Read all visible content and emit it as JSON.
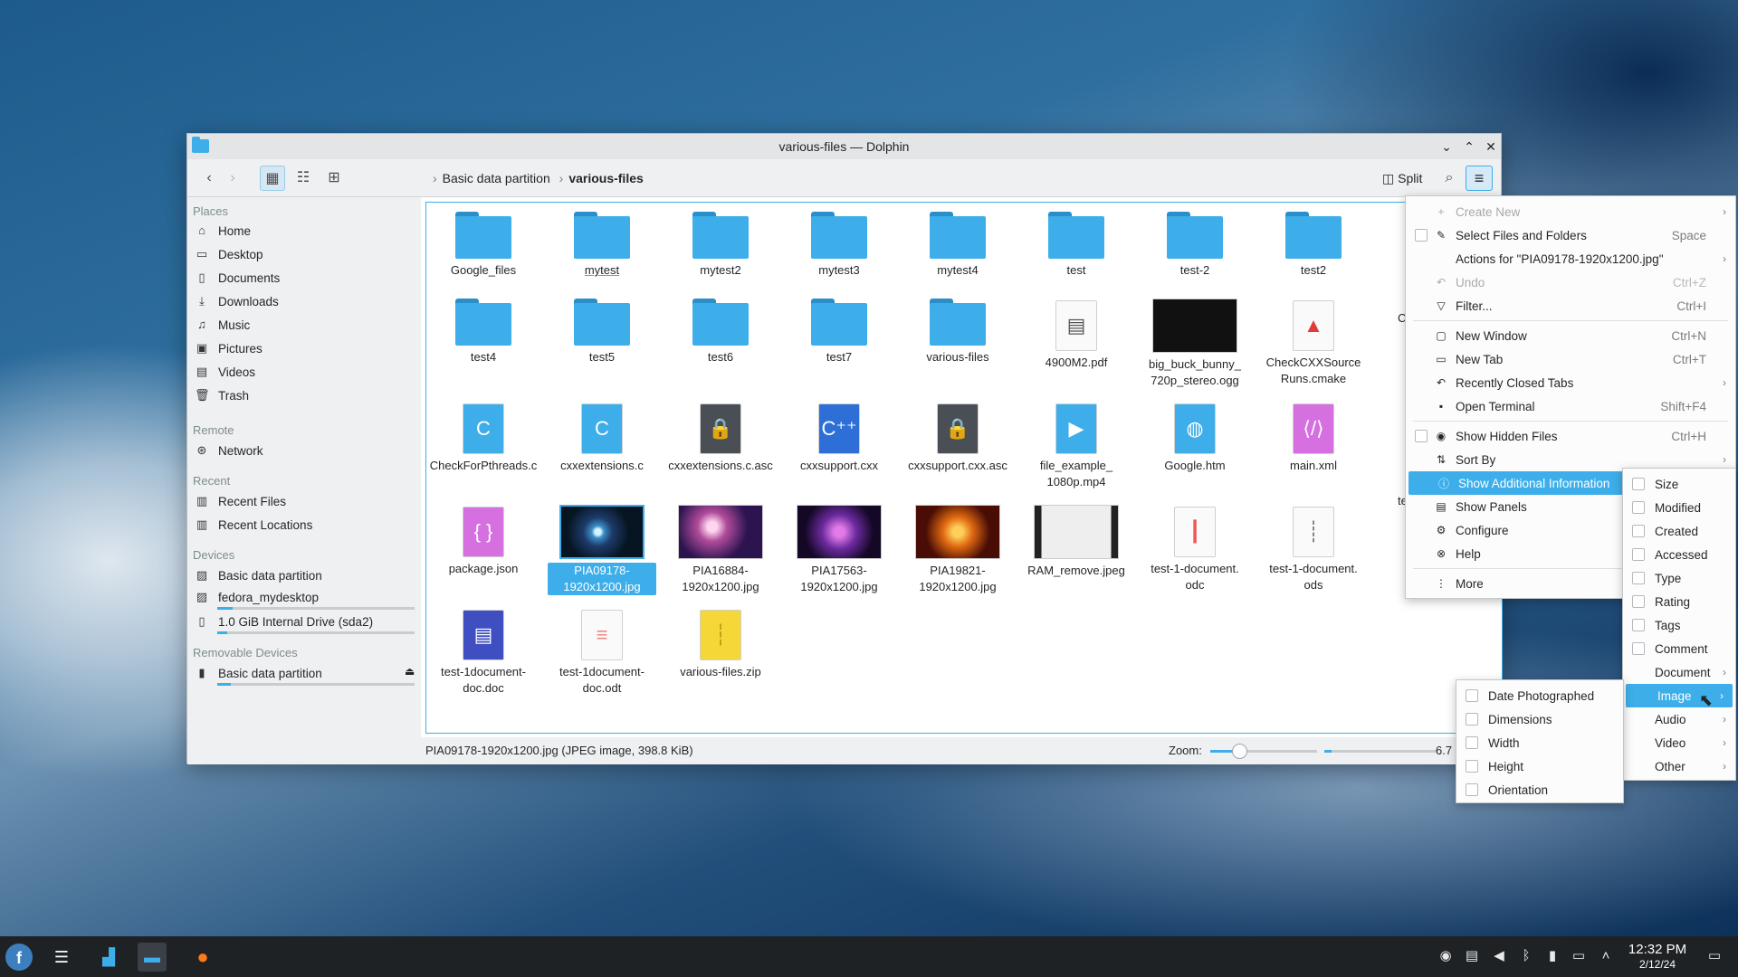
{
  "window": {
    "title": "various-files — Dolphin"
  },
  "toolbar": {
    "breadcrumb": [
      "Basic data partition",
      "various-files"
    ],
    "split_label": "Split"
  },
  "sidebar": {
    "places_header": "Places",
    "places": [
      "Home",
      "Desktop",
      "Documents",
      "Downloads",
      "Music",
      "Pictures",
      "Videos",
      "Trash"
    ],
    "remote_header": "Remote",
    "remote": [
      "Network"
    ],
    "recent_header": "Recent",
    "recent": [
      "Recent Files",
      "Recent Locations"
    ],
    "devices_header": "Devices",
    "devices": [
      {
        "label": "Basic data partition",
        "fill": null
      },
      {
        "label": "fedora_mydesktop",
        "fill": 0.08
      },
      {
        "label": "1.0 GiB Internal Drive (sda2)",
        "fill": 0.05
      }
    ],
    "removable_header": "Removable Devices",
    "removable": [
      {
        "label": "Basic data partition",
        "fill": 0.07
      }
    ]
  },
  "files": [
    {
      "name": "Google_files",
      "kind": "folder"
    },
    {
      "name": "mytest",
      "kind": "folder"
    },
    {
      "name": "mytest2",
      "kind": "folder"
    },
    {
      "name": "mytest3",
      "kind": "folder"
    },
    {
      "name": "mytest4",
      "kind": "folder"
    },
    {
      "name": "test",
      "kind": "folder"
    },
    {
      "name": "test-2",
      "kind": "folder"
    },
    {
      "name": "test2",
      "kind": "folder"
    },
    {
      "name": "test4",
      "kind": "folder"
    },
    {
      "name": "test5",
      "kind": "folder"
    },
    {
      "name": "test6",
      "kind": "folder"
    },
    {
      "name": "test7",
      "kind": "folder"
    },
    {
      "name": "various-files",
      "kind": "folder"
    },
    {
      "name": "4900M2.pdf",
      "kind": "pdf"
    },
    {
      "name": "big_buck_bunny_\n720p_stereo.ogg",
      "kind": "video"
    },
    {
      "name": "CheckCXXSource\nRuns.cmake",
      "kind": "cmake"
    },
    {
      "name": "CheckForPthreads.c",
      "kind": "c"
    },
    {
      "name": "cxxextensions.c",
      "kind": "c"
    },
    {
      "name": "cxxextensions.c.asc",
      "kind": "asc"
    },
    {
      "name": "cxxsupport.cxx",
      "kind": "cxx"
    },
    {
      "name": "cxxsupport.cxx.asc",
      "kind": "asc"
    },
    {
      "name": "file_example_\n1080p.mp4",
      "kind": "mp4"
    },
    {
      "name": "Google.htm",
      "kind": "htm"
    },
    {
      "name": "main.xml",
      "kind": "xml"
    },
    {
      "name": "package.json",
      "kind": "json"
    },
    {
      "name": "PIA09178-\n1920x1200.jpg",
      "kind": "img1",
      "selected": true
    },
    {
      "name": "PIA16884-\n1920x1200.jpg",
      "kind": "img2"
    },
    {
      "name": "PIA17563-\n1920x1200.jpg",
      "kind": "img3"
    },
    {
      "name": "PIA19821-\n1920x1200.jpg",
      "kind": "img4"
    },
    {
      "name": "RAM_remove.jpeg",
      "kind": "img5"
    },
    {
      "name": "test-1-document.\nodc",
      "kind": "odc"
    },
    {
      "name": "test-1-document.\nods",
      "kind": "ods"
    },
    {
      "name": "test-1document-\ndoc.doc",
      "kind": "docx"
    },
    {
      "name": "test-1document-\ndoc.odt",
      "kind": "odt"
    },
    {
      "name": "various-files.zip",
      "kind": "zip"
    }
  ],
  "partial_labels": [
    "Ch",
    "test"
  ],
  "statusbar": {
    "text": "PIA09178-1920x1200.jpg (JPEG image, 398.8 KiB)",
    "zoom_label": "Zoom:",
    "free": "6.7"
  },
  "menu": [
    {
      "label": "Create New",
      "disabled": true,
      "icon": "plus-icon",
      "submenu": true
    },
    {
      "label": "Select Files and Folders",
      "shortcut": "Space",
      "checkbox": true,
      "icon": "select-icon"
    },
    {
      "label": "Actions for \"PIA09178-1920x1200.jpg\"",
      "submenu": true
    },
    {
      "label": "Undo",
      "shortcut": "Ctrl+Z",
      "disabled": true,
      "icon": "undo-icon"
    },
    {
      "label": "Filter...",
      "shortcut": "Ctrl+I",
      "icon": "filter-icon"
    },
    {
      "separator": true
    },
    {
      "label": "New Window",
      "shortcut": "Ctrl+N",
      "icon": "window-icon"
    },
    {
      "label": "New Tab",
      "shortcut": "Ctrl+T",
      "icon": "tab-icon"
    },
    {
      "label": "Recently Closed Tabs",
      "submenu": true,
      "icon": "undo-icon"
    },
    {
      "label": "Open Terminal",
      "shortcut": "Shift+F4",
      "icon": "terminal-icon"
    },
    {
      "separator": true
    },
    {
      "label": "Show Hidden Files",
      "shortcut": "Ctrl+H",
      "checkbox": true,
      "icon": "eye-icon"
    },
    {
      "label": "Sort By",
      "submenu": true,
      "icon": "sort-icon"
    },
    {
      "label": "Show Additional Information",
      "highlighted": true,
      "icon": "info-icon"
    },
    {
      "label": "Show Panels",
      "icon": "panels-icon"
    },
    {
      "label": "Configure",
      "icon": "configure-icon"
    },
    {
      "label": "Help",
      "icon": "help-icon"
    },
    {
      "separator": true
    },
    {
      "label": "More",
      "icon": "more-icon"
    }
  ],
  "info_menu": [
    {
      "label": "Size"
    },
    {
      "label": "Modified"
    },
    {
      "label": "Created"
    },
    {
      "label": "Accessed"
    },
    {
      "label": "Type"
    },
    {
      "label": "Rating"
    },
    {
      "label": "Tags"
    },
    {
      "label": "Comment"
    },
    {
      "label": "Document",
      "submenu": true
    },
    {
      "label": "Image",
      "submenu": true,
      "highlighted": true
    },
    {
      "label": "Audio",
      "submenu": true
    },
    {
      "label": "Video",
      "submenu": true
    },
    {
      "label": "Other",
      "submenu": true
    }
  ],
  "image_menu": [
    {
      "label": "Date Photographed"
    },
    {
      "label": "Dimensions"
    },
    {
      "label": "Width"
    },
    {
      "label": "Height"
    },
    {
      "label": "Orientation"
    }
  ],
  "taskbar": {
    "time": "12:32 PM",
    "date": "2/12/24"
  },
  "colors": {
    "accent": "#3daee9",
    "folder": "#3daee9",
    "taskbar": "#1f2224"
  }
}
